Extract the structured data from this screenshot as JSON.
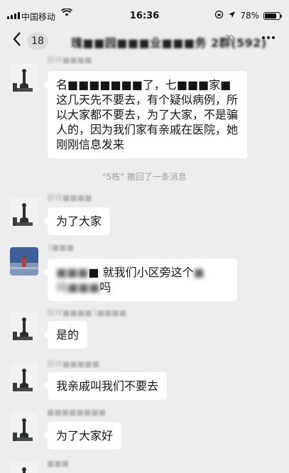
{
  "status_bar": {
    "carrier": "中国移动",
    "time": "16:36",
    "battery": "78%",
    "battery_level": 0.78,
    "icons": [
      "signal-icon",
      "wifi-icon",
      "lock-rotation-icon",
      "location-icon",
      "battery-icon"
    ]
  },
  "nav": {
    "back_icon": "chevron-left-icon",
    "unread_count": "18",
    "title": "瑰■■园■■■业■■■务 2群(592)",
    "mute_icon": "mute-icon",
    "more_icon": "more-icon"
  },
  "messages": [
    {
      "sender": "振祥■■■■",
      "avatar": "statue-avatar",
      "text": "名■■■■■■■了，七■■■家■这几天先不要去，有个疑似病例，所以大家都不要去，为了大家，不是骗人的，因为我们家有亲戚在医院，她刚刚信息发来"
    },
    {
      "system": "\"5栋\" 撤回了一条消息"
    },
    {
      "sender": "振祥■■■■",
      "avatar": "statue-avatar",
      "text": "为了大家"
    },
    {
      "sender": "3■■■",
      "avatar": "landscape-avatar",
      "text_blur_1": "■■■",
      "text_mid": "■ 就我们小区旁这个",
      "text_blur_2": "■",
      "text_line2_blur": "纯■■■",
      "text_line2_end": "吗"
    },
    {
      "sender": "振祥■■■■3■■■■",
      "avatar": "statue-avatar",
      "text": "是的"
    },
    {
      "sender": "振祥■■■■■",
      "avatar": "statue-avatar",
      "text": "我亲戚叫我们不要去"
    },
    {
      "sender": "■■■■■■■■",
      "avatar": "statue-avatar",
      "text": "为了大家好"
    },
    {
      "sender": "■■■",
      "avatar": "statue-avatar"
    }
  ],
  "colors": {
    "background": "#ededed",
    "bubble": "#ffffff",
    "system_text": "#a0a0a0"
  }
}
